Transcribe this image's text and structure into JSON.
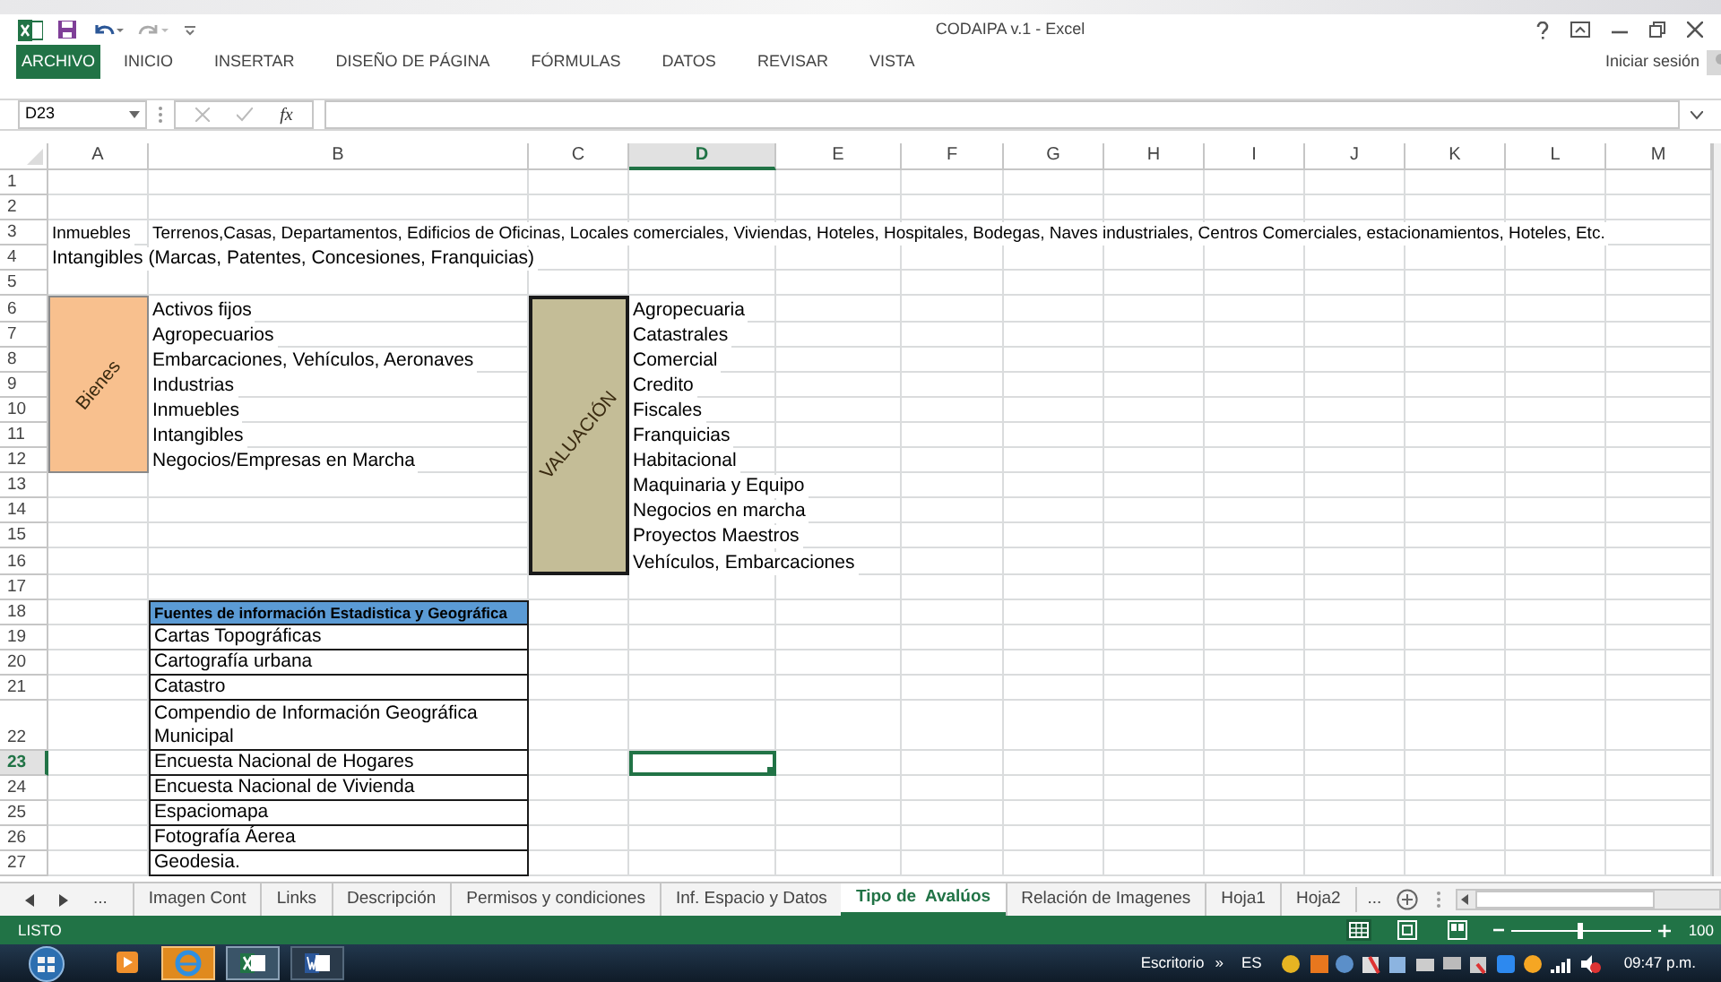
{
  "window": {
    "title": "CODAIPA v.1 - Excel"
  },
  "ribbon_tabs": [
    {
      "label": "ARCHIVO",
      "selected": true
    },
    {
      "label": "INICIO",
      "selected": false
    },
    {
      "label": "INSERTAR",
      "selected": false
    },
    {
      "label": "DISEÑO DE PÁGINA",
      "selected": false
    },
    {
      "label": "FÓRMULAS",
      "selected": false
    },
    {
      "label": "DATOS",
      "selected": false
    },
    {
      "label": "REVISAR",
      "selected": false
    },
    {
      "label": "VISTA",
      "selected": false
    }
  ],
  "account": "Iniciar sesión",
  "formula_bar": {
    "name_box": "D23",
    "function_label": "fx"
  },
  "sheet": {
    "columns": [
      {
        "label": "A",
        "selected": false
      },
      {
        "label": "B",
        "selected": false
      },
      {
        "label": "C",
        "selected": false
      },
      {
        "label": "D",
        "selected": true
      },
      {
        "label": "E",
        "selected": false
      },
      {
        "label": "F",
        "selected": false
      },
      {
        "label": "G",
        "selected": false
      },
      {
        "label": "H",
        "selected": false
      },
      {
        "label": "I",
        "selected": false
      },
      {
        "label": "J",
        "selected": false
      },
      {
        "label": "K",
        "selected": false
      },
      {
        "label": "L",
        "selected": false
      },
      {
        "label": "M",
        "selected": false
      }
    ],
    "rows": [
      {
        "label": "1",
        "selected": false
      },
      {
        "label": "2",
        "selected": false
      },
      {
        "label": "3",
        "selected": false
      },
      {
        "label": "4",
        "selected": false
      },
      {
        "label": "5",
        "selected": false
      },
      {
        "label": "6",
        "selected": false
      },
      {
        "label": "7",
        "selected": false
      },
      {
        "label": "8",
        "selected": false
      },
      {
        "label": "9",
        "selected": false
      },
      {
        "label": "10",
        "selected": false
      },
      {
        "label": "11",
        "selected": false
      },
      {
        "label": "12",
        "selected": false
      },
      {
        "label": "13",
        "selected": false
      },
      {
        "label": "14",
        "selected": false
      },
      {
        "label": "15",
        "selected": false
      },
      {
        "label": "16",
        "selected": false
      },
      {
        "label": "17",
        "selected": false
      },
      {
        "label": "18",
        "selected": false
      },
      {
        "label": "19",
        "selected": false
      },
      {
        "label": "20",
        "selected": false
      },
      {
        "label": "21",
        "selected": false
      },
      {
        "label": "22",
        "selected": false
      },
      {
        "label": "23",
        "selected": true
      },
      {
        "label": "24",
        "selected": false
      },
      {
        "label": "25",
        "selected": false
      },
      {
        "label": "26",
        "selected": false
      },
      {
        "label": "27",
        "selected": false
      }
    ],
    "cells": {
      "A3": "Inmuebles",
      "B3": "Terrenos,Casas, Departamentos, Edificios de Oficinas, Locales comerciales, Viviendas, Hoteles, Hospitales, Bodegas, Naves industriales, Centros Comerciales, estacionamientos, Hoteles, Etc.",
      "A4": "Intangibles (Marcas, Patentes, Concesiones, Franquicias)",
      "B6": "Activos fijos",
      "B7": "Agropecuarios",
      "B8": "Embarcaciones, Vehículos, Aeronaves",
      "B9": "Industrias",
      "B10": "Inmuebles",
      "B11": "Intangibles",
      "B12": "Negocios/Empresas en Marcha",
      "D6": "Agropecuaria",
      "D7": "Catastrales",
      "D8": "Comercial",
      "D9": "Credito",
      "D10": "Fiscales",
      "D11": "Franquicias",
      "D12": "Habitacional",
      "D13": "Maquinaria y Equipo",
      "D14": "Negocios en marcha",
      "D15": "Proyectos Maestros",
      "D16": "Vehículos, Embarcaciones"
    },
    "merged": {
      "A6:A12": {
        "text": "Bienes",
        "color": "#f8c08e",
        "kind": "plain"
      },
      "C6:C16": {
        "text": "VALUACIÓN",
        "color": "#c4bd97",
        "kind": "framed"
      }
    },
    "tables": {
      "B18": {
        "header": "Fuentes de información Estadistica y Geográfica",
        "rows": [
          "Cartas Topográficas",
          "Cartografía urbana",
          "Catastro",
          "Compendio de Información Geográfica Municipal",
          "Encuesta Nacional de Hogares",
          "Encuesta Nacional de Vivienda",
          "Espaciomapa",
          "Fotografía Áerea",
          "Geodesia."
        ]
      }
    }
  },
  "sheet_tabs": {
    "more_left": "...",
    "tabs": [
      {
        "label": "Imagen Cont",
        "selected": false
      },
      {
        "label": "Links",
        "selected": false
      },
      {
        "label": "Descripción",
        "selected": false
      },
      {
        "label": "Permisos y condiciones",
        "selected": false
      },
      {
        "label": "Inf. Espacio y Datos",
        "selected": false
      },
      {
        "label": "Tipo de  Avalúos",
        "selected": true
      },
      {
        "label": "Relación de Imagenes",
        "selected": false
      },
      {
        "label": "Hoja1",
        "selected": false
      },
      {
        "label": "Hoja2",
        "selected": false
      }
    ],
    "more_right": "..."
  },
  "status_bar": {
    "status": "LISTO",
    "zoom": {
      "level": 0.5,
      "reading": "100"
    }
  },
  "taskbar": {
    "desktop": "Escritorio",
    "chevron": "»",
    "language": "ES",
    "clock": "09:47 p.m."
  }
}
